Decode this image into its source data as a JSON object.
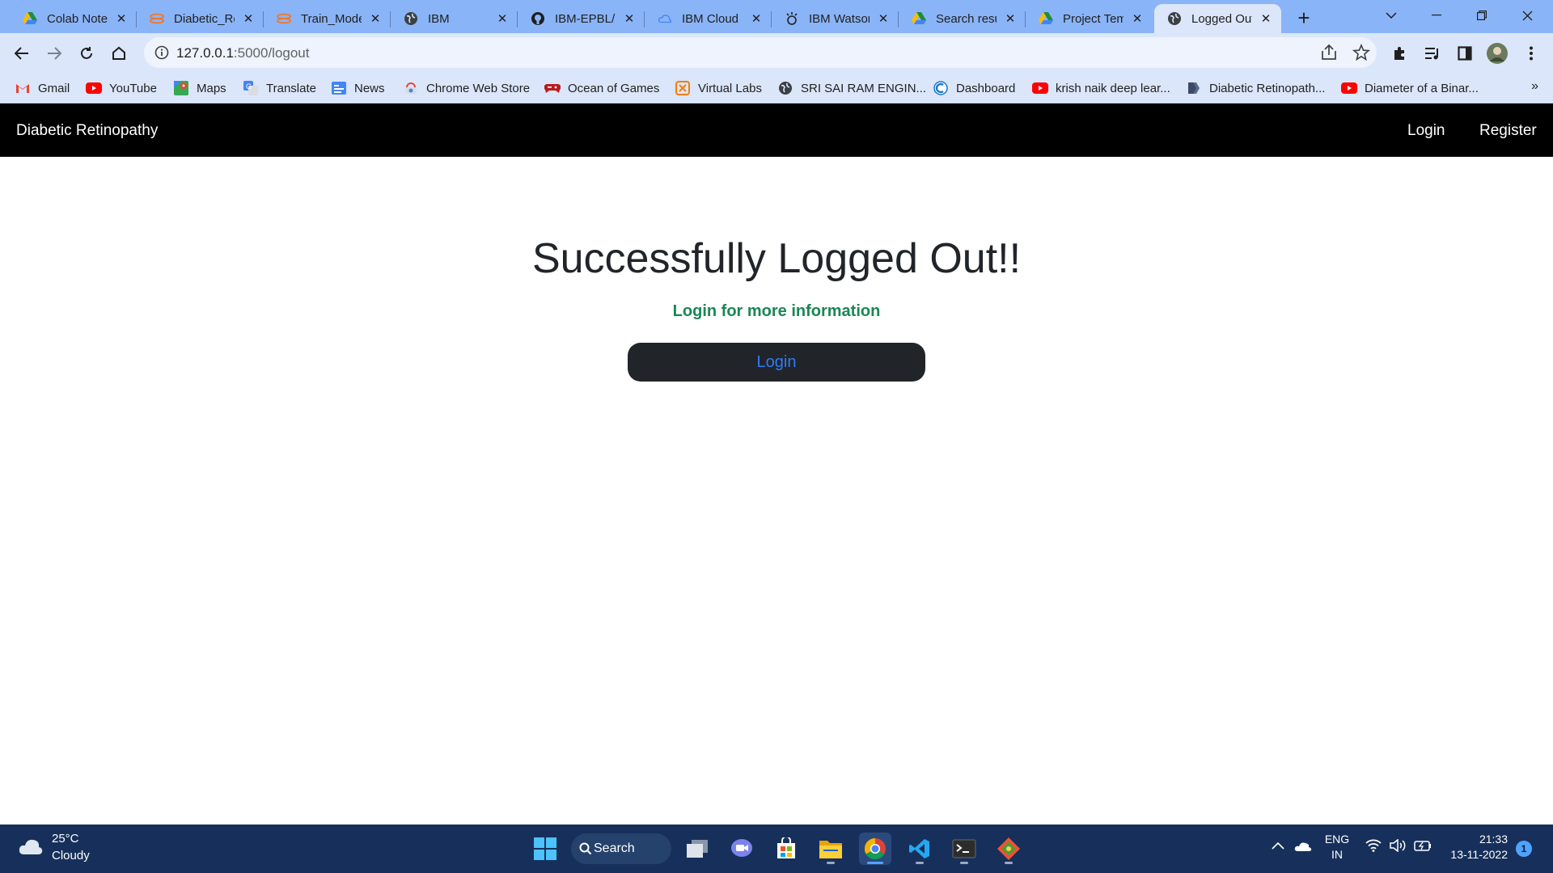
{
  "browser": {
    "tabs": [
      {
        "title": "Colab Notebooks",
        "icon": "google-drive-icon",
        "active": false
      },
      {
        "title": "Diabetic_Retinopathy",
        "icon": "jupyter-icon",
        "active": false
      },
      {
        "title": "Train_Model",
        "icon": "jupyter-icon",
        "active": false
      },
      {
        "title": "IBM",
        "icon": "globe-icon",
        "active": false
      },
      {
        "title": "IBM-EPBL/IBM-Project",
        "icon": "github-icon",
        "active": false
      },
      {
        "title": "IBM Cloud",
        "icon": "cloud-icon",
        "active": false
      },
      {
        "title": "IBM Watson Studio",
        "icon": "watson-icon",
        "active": false
      },
      {
        "title": "Search results",
        "icon": "google-drive-icon",
        "active": false
      },
      {
        "title": "Project Templates",
        "icon": "google-drive-icon",
        "active": false
      },
      {
        "title": "Logged Out",
        "icon": "globe-icon",
        "active": true
      }
    ],
    "tab_close_glyph": "✕",
    "new_tab_glyph": "+",
    "url_host": "127.0.0.1",
    "url_path": ":5000/logout",
    "bookmarks": [
      {
        "label": "Gmail",
        "icon": "gmail-icon"
      },
      {
        "label": "YouTube",
        "icon": "youtube-icon"
      },
      {
        "label": "Maps",
        "icon": "maps-icon"
      },
      {
        "label": "Translate",
        "icon": "translate-icon"
      },
      {
        "label": "News",
        "icon": "news-icon"
      },
      {
        "label": "Chrome Web Store",
        "icon": "web-store-icon"
      },
      {
        "label": "Ocean of Games",
        "icon": "gamepad-icon"
      },
      {
        "label": "Virtual Labs",
        "icon": "virtual-labs-icon"
      },
      {
        "label": "SRI SAI RAM ENGIN...",
        "icon": "globe-icon"
      },
      {
        "label": "Dashboard",
        "icon": "dashboard-icon"
      },
      {
        "label": "krish naik deep lear...",
        "icon": "youtube-icon"
      },
      {
        "label": "Diabetic Retinopath...",
        "icon": "bookmark-page-icon"
      },
      {
        "label": "Diameter of a Binar...",
        "icon": "youtube-icon"
      }
    ],
    "bookmarks_more_glyph": "»"
  },
  "page": {
    "brand": "Diabetic Retinopathy",
    "nav_login": "Login",
    "nav_register": "Register",
    "heading": "Successfully Logged Out!!",
    "subtext": "Login for more information",
    "login_button": "Login"
  },
  "taskbar": {
    "temperature": "25°C",
    "weather": "Cloudy",
    "search_label": "Search",
    "lang_line1": "ENG",
    "lang_line2": "IN",
    "time": "21:33",
    "date": "13-11-2022",
    "notification_count": "1"
  },
  "colors": {
    "tabstrip": "#8ab4f8",
    "toolbar": "#dbe6fb",
    "navbar": "#000000",
    "heading": "#212529",
    "subtext": "#198754",
    "button_bg": "#212529",
    "button_text": "#2f7bf5",
    "taskbar": "#17305b"
  }
}
